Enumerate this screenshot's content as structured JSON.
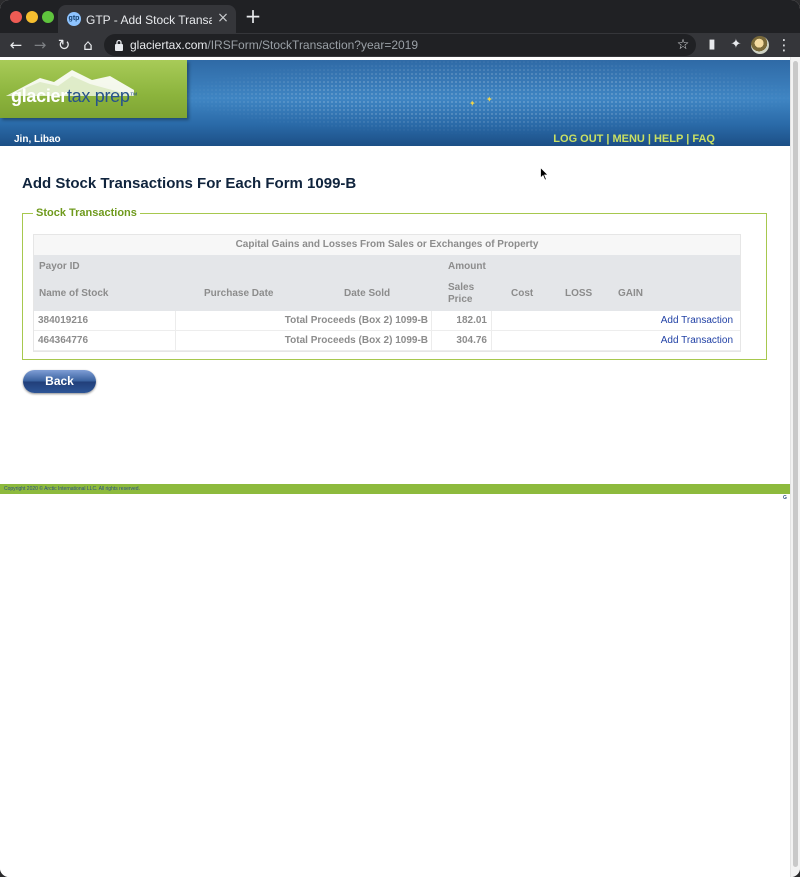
{
  "browser": {
    "tab_title": "GTP - Add Stock Transactions",
    "tab_favicon_text": "gtp",
    "url_host": "glaciertax.com",
    "url_path": "/IRSForm/StockTransaction?year=2019",
    "icons": {
      "back": "←",
      "forward": "→",
      "reload": "↻",
      "home": "⌂",
      "close": "×",
      "new_tab": "+",
      "bookmark": "☆",
      "reading_list": "▮",
      "extensions": "✦",
      "menu": "⋮"
    }
  },
  "header": {
    "logo_word1": "glacier",
    "logo_word2": "tax prep",
    "logo_tm": "™",
    "user_name": "Jin, Libao",
    "nav": {
      "logout": "LOG OUT",
      "menu": "MENU",
      "help": "HELP",
      "faq": "FAQ",
      "separator": "|"
    },
    "colors": {
      "banner_blue": "#3f85c3",
      "logo_green": "#8cb43d",
      "link_yellow_green": "#c9e063"
    }
  },
  "main": {
    "page_title": "Add Stock Transactions For Each Form 1099-B",
    "section_legend": "Stock Transactions",
    "table": {
      "caption": "Capital Gains and Losses From Sales or Exchanges of Property",
      "head_row1": {
        "payor_id": "Payor ID",
        "amount": "Amount"
      },
      "head_row2": {
        "name_of_stock": "Name of Stock",
        "purchase_date": "Purchase Date",
        "date_sold": "Date Sold",
        "sales_price": "Sales Price",
        "cost": "Cost",
        "loss": "LOSS",
        "gain": "GAIN"
      },
      "rows": [
        {
          "payor_id": "384019216",
          "label": "Total Proceeds (Box 2) 1099-B",
          "amount": "182.01",
          "action": "Add Transaction"
        },
        {
          "payor_id": "464364776",
          "label": "Total Proceeds (Box 2) 1099-B",
          "amount": "304.76",
          "action": "Add Transaction"
        }
      ]
    },
    "back_button": "Back"
  },
  "footer": {
    "copyright": "Copyright 2020 © Arctic International LLC. All rights reserved.",
    "corner_mark": "G",
    "bar_color": "#8dba3d"
  }
}
